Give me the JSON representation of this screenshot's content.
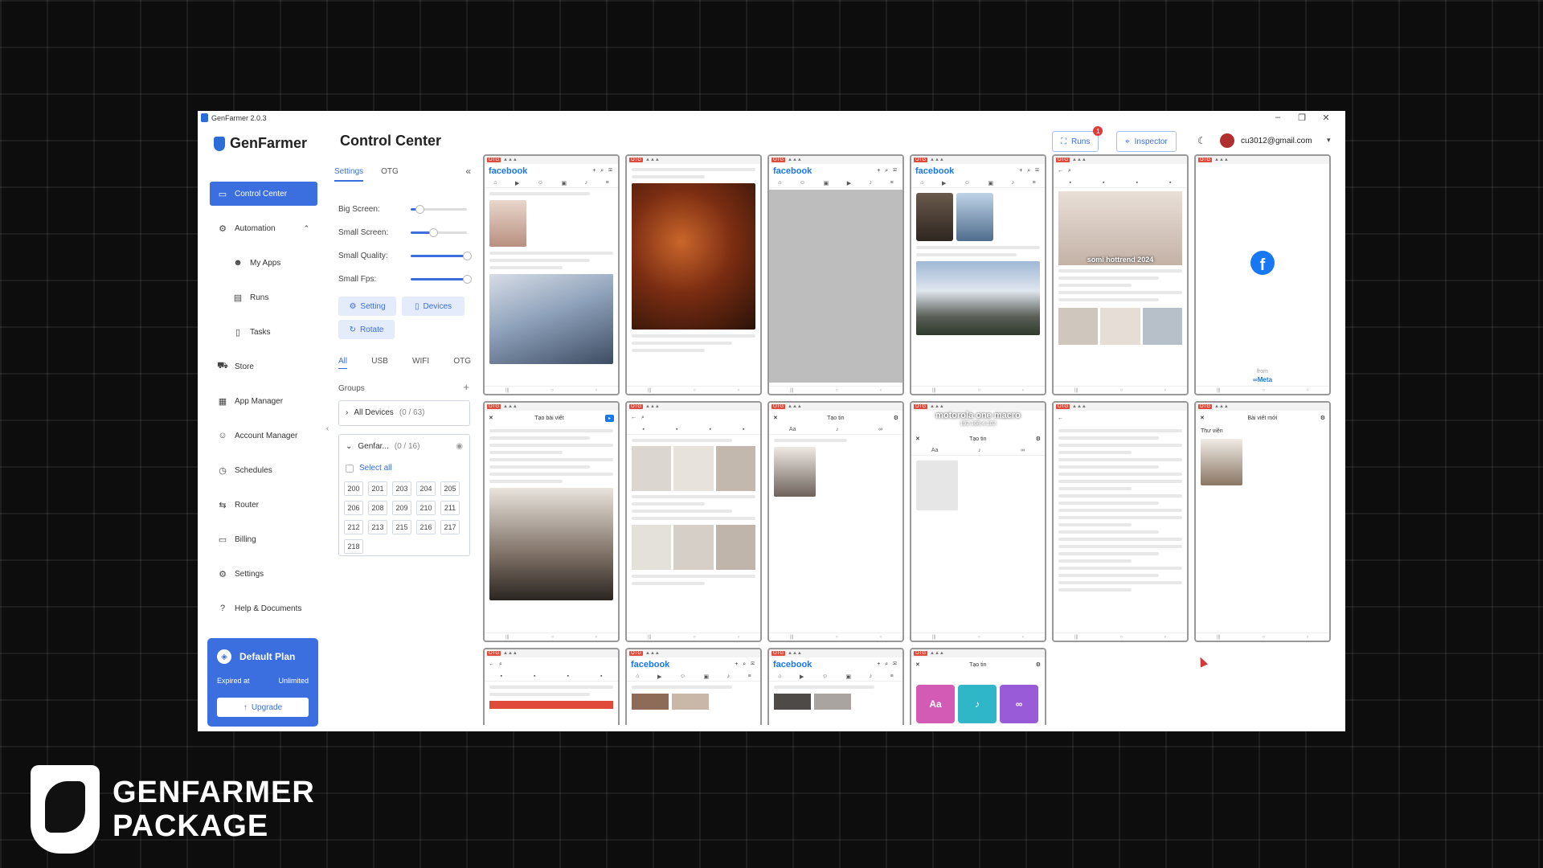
{
  "window": {
    "title": "GenFarmer 2.0.3"
  },
  "brand": {
    "name": "GenFarmer"
  },
  "nav": {
    "control_center": "Control Center",
    "automation": "Automation",
    "my_apps": "My Apps",
    "runs": "Runs",
    "tasks": "Tasks",
    "store": "Store",
    "app_manager": "App Manager",
    "account_manager": "Account Manager",
    "schedules": "Schedules",
    "router": "Router",
    "billing": "Billing",
    "settings": "Settings",
    "help": "Help & Documents"
  },
  "plan": {
    "name": "Default Plan",
    "expired_label": "Expired at",
    "expired_value": "Unlimited",
    "upgrade": "Upgrade"
  },
  "header": {
    "title": "Control Center",
    "runs": "Runs",
    "runs_badge": "1",
    "inspector": "Inspector",
    "email": "cu3012@gmail.com"
  },
  "panel": {
    "tabs": [
      "Settings",
      "OTG"
    ],
    "sliders": [
      {
        "label": "Big Screen:",
        "value": 0.15
      },
      {
        "label": "Small Screen:",
        "value": 0.4
      },
      {
        "label": "Small Quality:",
        "value": 1.0
      },
      {
        "label": "Small Fps:",
        "value": 1.0
      }
    ],
    "setting_btn": "Setting",
    "devices_btn": "Devices",
    "rotate_btn": "Rotate",
    "filters": [
      "All",
      "USB",
      "WIFI",
      "OTG"
    ],
    "groups_label": "Groups",
    "all_devices": "All Devices",
    "all_devices_count": "(0 / 63)",
    "group_name": "Genfar...",
    "group_count": "(0 / 16)",
    "select_all": "Select all",
    "device_ids": [
      "200",
      "201",
      "203",
      "204",
      "205",
      "206",
      "208",
      "209",
      "210",
      "211",
      "212",
      "213",
      "215",
      "216",
      "217",
      "218"
    ]
  },
  "phones": {
    "facebook": "facebook",
    "p2_caption": "somi hottrend 2024",
    "p3_model": "motorola one macro",
    "p3_ip": "192.168.4.102",
    "meta_from": "from",
    "meta_name": "∞Meta",
    "create_post": "Tạo bài viết",
    "new_post": "Bài viết mới",
    "create_story": "Tạo tin",
    "library": "Thư viện",
    "fb_letter": "f"
  },
  "watermark": {
    "line1": "GENFARMER",
    "line2": "PACKAGE"
  },
  "colors": {
    "accent": "#3b6fe0",
    "facebook": "#1877f2",
    "badge": "#e03a3a"
  }
}
